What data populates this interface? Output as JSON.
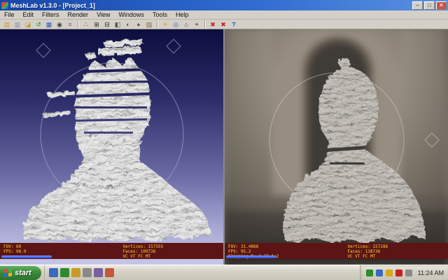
{
  "window": {
    "title": "MeshLab v1.3.0 - [Project_1]",
    "controls": {
      "min": "–",
      "max": "□",
      "close": "✕"
    }
  },
  "menu": {
    "items": [
      "File",
      "Edit",
      "Filters",
      "Render",
      "View",
      "Windows",
      "Tools",
      "Help"
    ]
  },
  "toolbar": {
    "icons": [
      {
        "name": "open-project-icon",
        "g": "▤"
      },
      {
        "name": "save-project-icon",
        "g": "▥"
      },
      {
        "name": "open-mesh-icon",
        "g": "◪"
      },
      {
        "name": "reload-mesh-icon",
        "g": "↺"
      },
      {
        "name": "save-mesh-icon",
        "g": "▦"
      },
      {
        "name": "snapshot-icon",
        "g": "◉"
      },
      {
        "name": "layers-icon",
        "g": "≡"
      },
      {
        "name": "points-mode-icon",
        "g": "∴"
      },
      {
        "name": "wireframe-mode-icon",
        "g": "⊞"
      },
      {
        "name": "hidden-lines-icon",
        "g": "⊟"
      },
      {
        "name": "flat-lines-icon",
        "g": "◧"
      },
      {
        "name": "flat-shade-icon",
        "g": "◐"
      },
      {
        "name": "smooth-shade-icon",
        "g": "●"
      },
      {
        "name": "texture-mode-icon",
        "g": "▨"
      },
      {
        "name": "light-toggle-icon",
        "g": "☀"
      },
      {
        "name": "trackball-icon",
        "g": "◎"
      },
      {
        "name": "home-view-icon",
        "g": "⌂"
      },
      {
        "name": "zoom-fit-icon",
        "g": "⌖"
      },
      {
        "name": "delete-mesh-icon",
        "g": "✖"
      },
      {
        "name": "delete-raster-icon",
        "g": "✖"
      },
      {
        "name": "help-icon",
        "g": "?"
      }
    ]
  },
  "viewport_left": {
    "status": {
      "fov": "FOV: 60",
      "fps": "FPS: 98.9",
      "vertices": "Vertices: 157355",
      "faces": "Faces: 109736",
      "flags": "VC VT FC MT"
    }
  },
  "viewport_right": {
    "status": {
      "fov": "FOV: 31.4866",
      "fps": "FPS: 95.2",
      "clipping": "Clipping R:  2.37  1.2",
      "vertices": "Vertices: 157286",
      "faces": "Faces: 138736",
      "flags": "VC VT FC MT"
    }
  },
  "taskbar": {
    "start_label": "start",
    "clock": "11:24 AM"
  },
  "colors": {
    "status_bg": "#5c1414",
    "status_text": "#ffd63a",
    "viewport_gradient_top": "#0d0d3e",
    "viewport_gradient_bottom": "#c6c6e8",
    "titlebar_blue": "#2f6bd0"
  }
}
